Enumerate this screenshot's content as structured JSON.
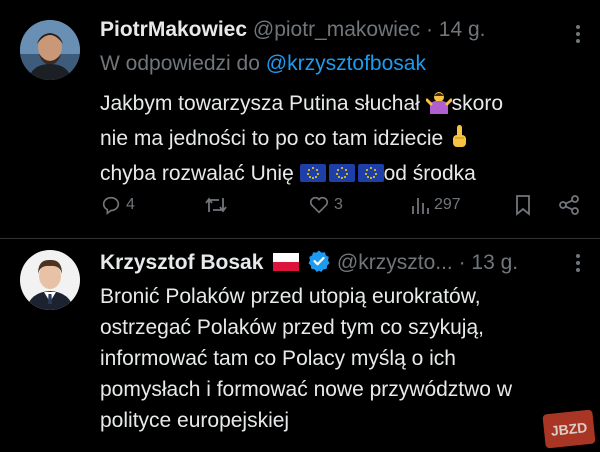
{
  "tweet1": {
    "display_name": "PiotrMakowiec",
    "handle": "@piotr_makowiec",
    "time": "· 14 g.",
    "reply_prefix": "W odpowiedzi do",
    "reply_to": "@krzysztofbosak",
    "text": {
      "l1a": "Jakbym towarzysza  Putina słuchał ",
      "l1b": "skoro",
      "l2": "nie ma jedności to po co tam idziecie ",
      "l3a": "chyba rozwalać Unię ",
      "l3b": "od środka"
    },
    "stats": {
      "replies": "4",
      "retweets": "",
      "likes": "3",
      "views": "297"
    }
  },
  "tweet2": {
    "display_name": "Krzysztof Bosak",
    "handle": "@krzyszto...",
    "time": "· 13 g.",
    "text": [
      "Bronić Polaków przed utopią eurokratów,",
      "ostrzegać Polaków przed tym co szykują,",
      "informować tam co Polacy myślą o ich",
      "pomysłach i formować nowe przywództwo w",
      "polityce europejskiej"
    ]
  },
  "watermark": "JBZD",
  "colors": {
    "background": "#000000",
    "text": "#e7e9ea",
    "muted": "#71767b",
    "link": "#1d9bf0",
    "verified": "#1d9bf0"
  }
}
